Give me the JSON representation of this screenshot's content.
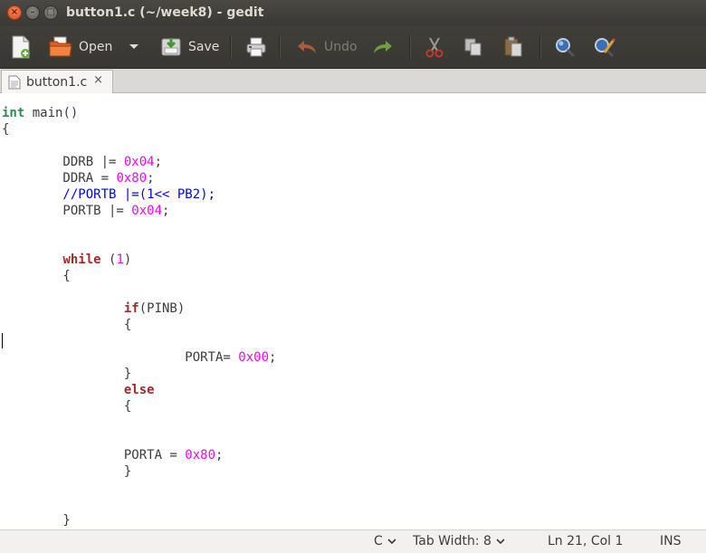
{
  "window": {
    "title": "button1.c (~/week8) - gedit"
  },
  "toolbar": {
    "new_label": "",
    "open_label": "Open",
    "save_label": "Save",
    "undo_label": "Undo"
  },
  "tabs": [
    {
      "label": "button1.c",
      "close": "×"
    }
  ],
  "code_lines": [
    [
      {
        "t": "int",
        "c": "type"
      },
      {
        "t": " main()",
        "c": ""
      }
    ],
    [
      {
        "t": "{",
        "c": ""
      }
    ],
    [],
    [
      {
        "t": "        DDRB |= ",
        "c": ""
      },
      {
        "t": "0x04",
        "c": "num"
      },
      {
        "t": ";",
        "c": ""
      }
    ],
    [
      {
        "t": "        DDRA = ",
        "c": ""
      },
      {
        "t": "0x80",
        "c": "num"
      },
      {
        "t": ";",
        "c": ""
      }
    ],
    [
      {
        "t": "        //PORTB |=(1<< PB2);",
        "c": "cmt"
      }
    ],
    [
      {
        "t": "        PORTB |= ",
        "c": ""
      },
      {
        "t": "0x04",
        "c": "num"
      },
      {
        "t": ";",
        "c": ""
      }
    ],
    [],
    [],
    [
      {
        "t": "        ",
        "c": ""
      },
      {
        "t": "while",
        "c": "kw"
      },
      {
        "t": " (",
        "c": ""
      },
      {
        "t": "1",
        "c": "num"
      },
      {
        "t": ")",
        "c": ""
      }
    ],
    [
      {
        "t": "        {",
        "c": ""
      }
    ],
    [],
    [
      {
        "t": "                ",
        "c": ""
      },
      {
        "t": "if",
        "c": "kw"
      },
      {
        "t": "(PINB)",
        "c": ""
      }
    ],
    [
      {
        "t": "                {",
        "c": ""
      }
    ],
    [],
    [
      {
        "t": "                        PORTA= ",
        "c": ""
      },
      {
        "t": "0x00",
        "c": "num"
      },
      {
        "t": ";",
        "c": ""
      }
    ],
    [
      {
        "t": "                }",
        "c": ""
      }
    ],
    [
      {
        "t": "                ",
        "c": ""
      },
      {
        "t": "else",
        "c": "kw"
      }
    ],
    [
      {
        "t": "                {",
        "c": ""
      }
    ],
    [],
    [],
    [
      {
        "t": "                PORTA = ",
        "c": ""
      },
      {
        "t": "0x80",
        "c": "num"
      },
      {
        "t": ";",
        "c": ""
      }
    ],
    [
      {
        "t": "                }",
        "c": ""
      }
    ],
    [],
    [],
    [
      {
        "t": "        }",
        "c": ""
      }
    ]
  ],
  "statusbar": {
    "language": "C",
    "tab_width": "Tab Width: 8",
    "position": "Ln 21, Col 1",
    "mode": "INS"
  },
  "colors": {
    "type": "#2e8b57",
    "keyword": "#a52a2a",
    "number": "#ff00ff",
    "comment": "#0000ff"
  }
}
